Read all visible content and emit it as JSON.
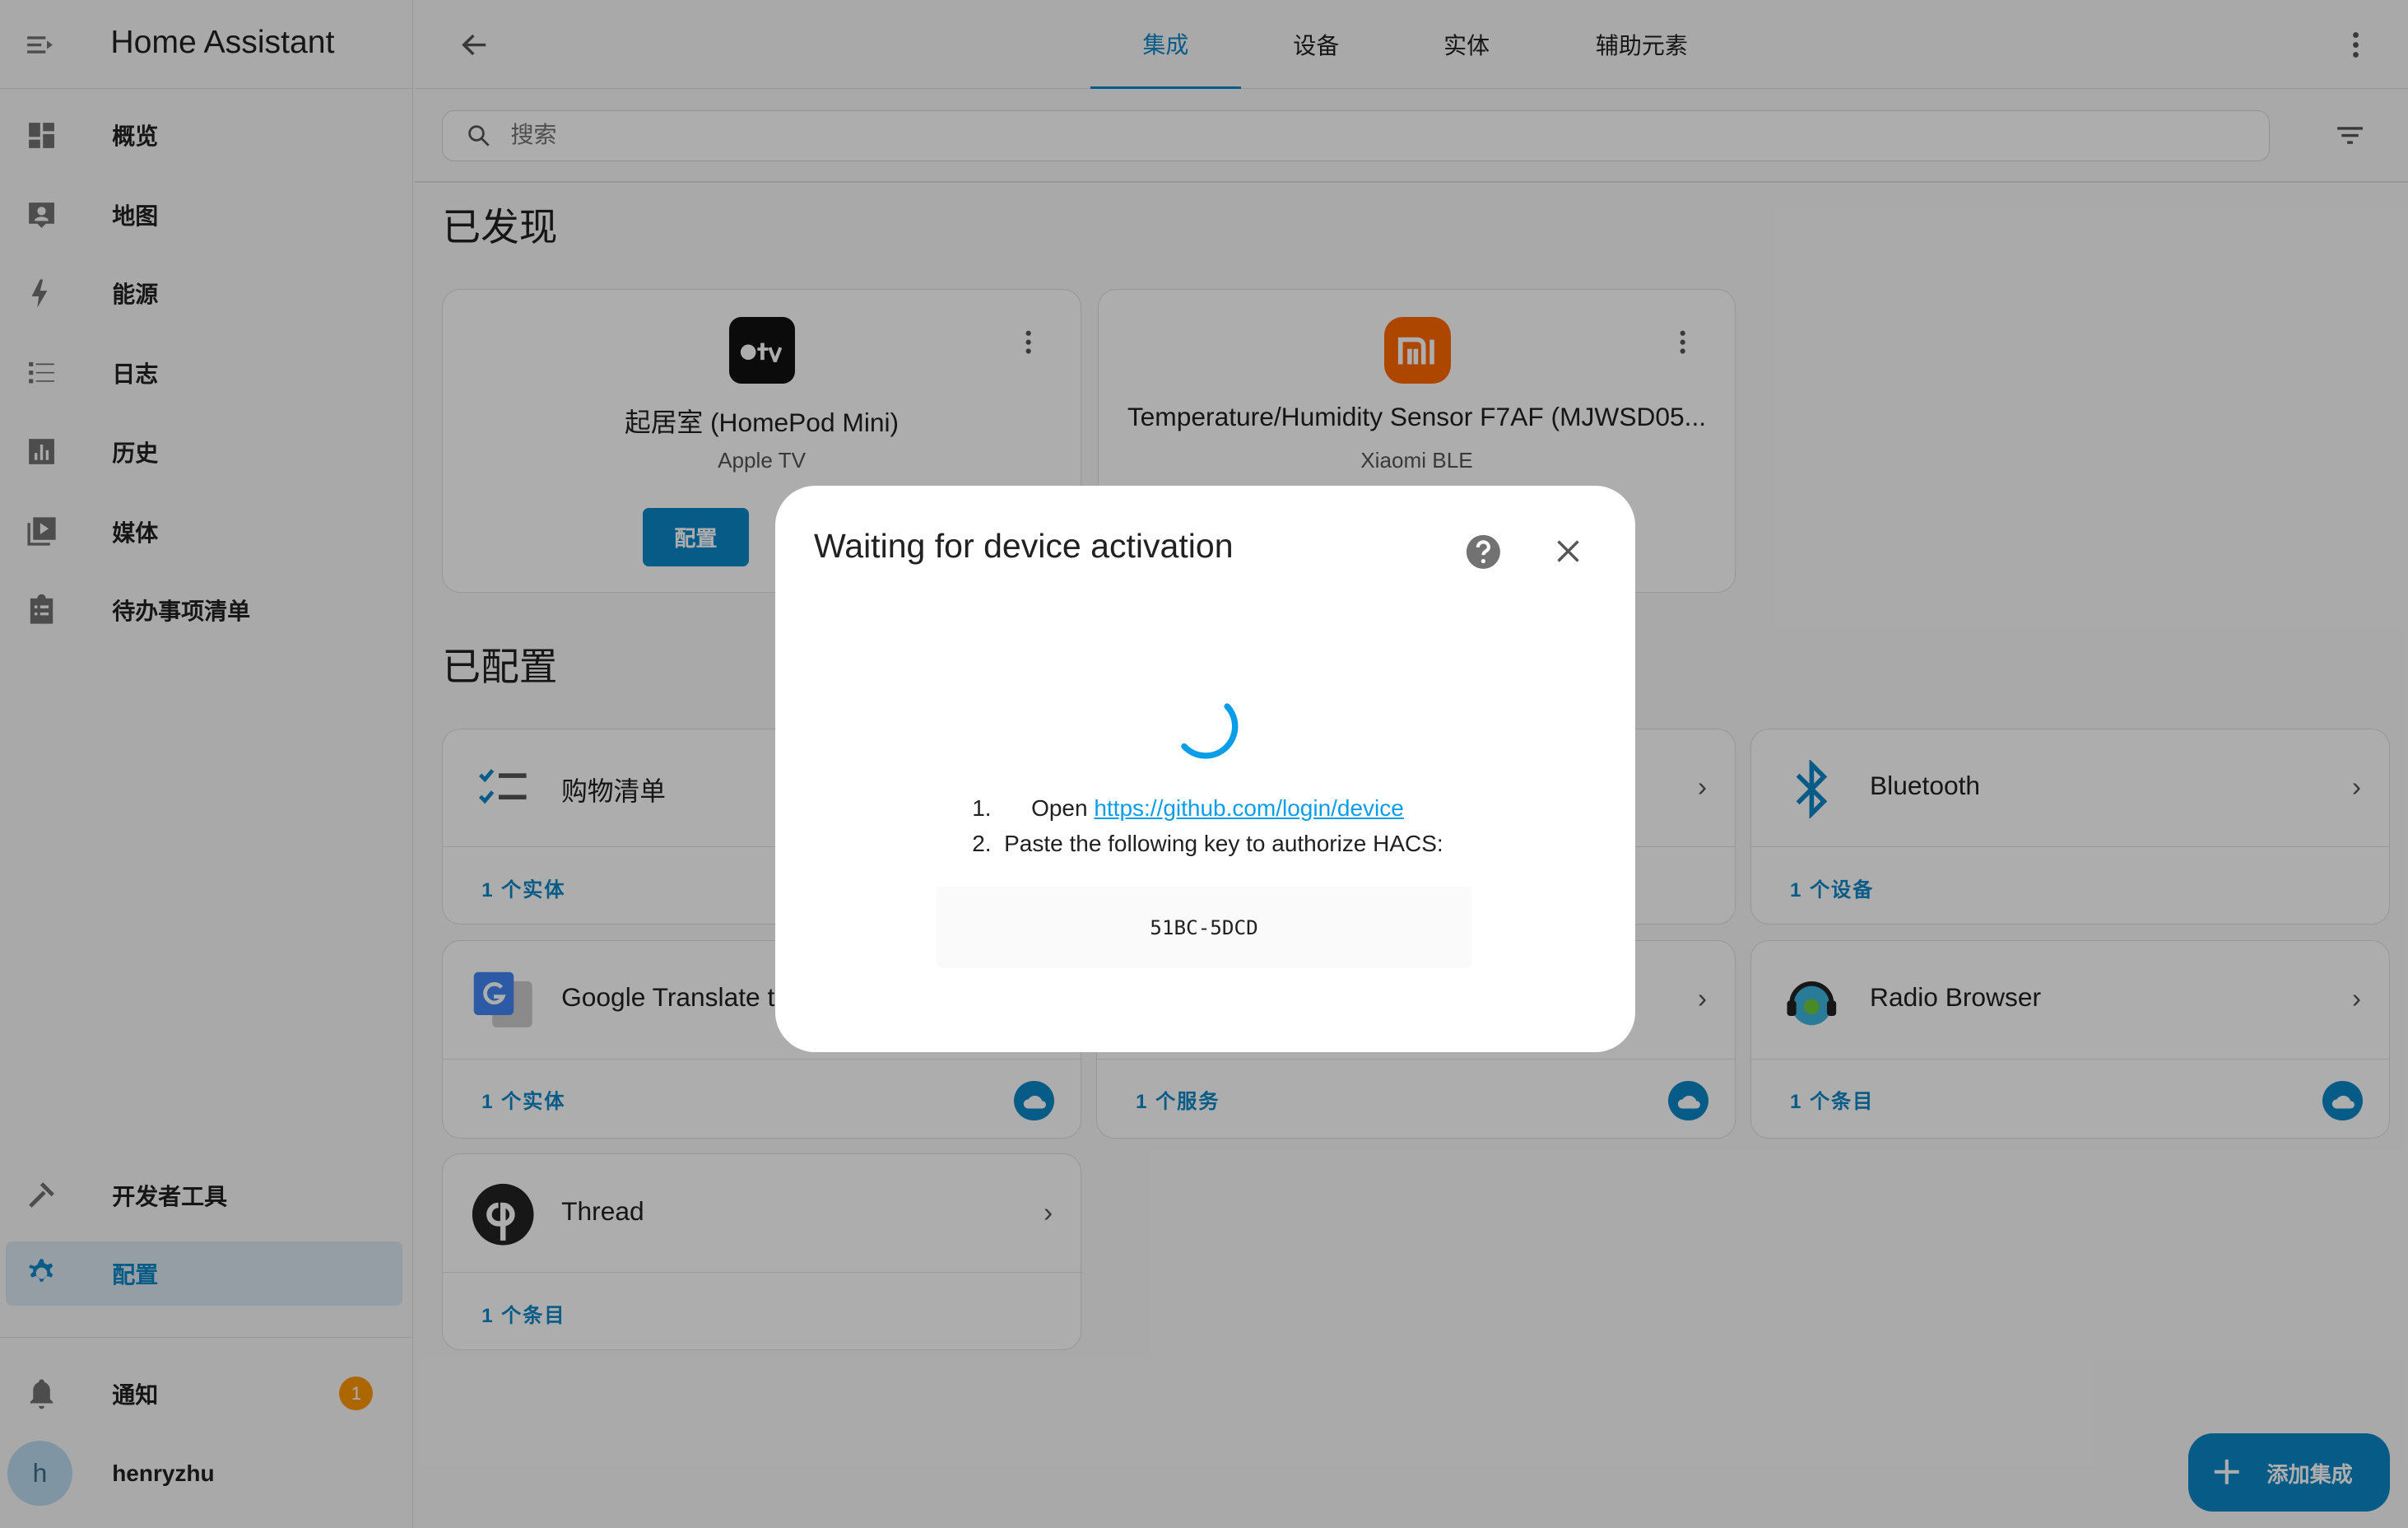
{
  "app": {
    "title": "Home Assistant"
  },
  "sidebar": {
    "items": [
      {
        "label": "概览",
        "icon": "dashboard-icon"
      },
      {
        "label": "地图",
        "icon": "map-icon"
      },
      {
        "label": "能源",
        "icon": "lightning-icon"
      },
      {
        "label": "日志",
        "icon": "list-icon"
      },
      {
        "label": "历史",
        "icon": "chart-icon"
      },
      {
        "label": "媒体",
        "icon": "media-icon"
      },
      {
        "label": "待办事项清单",
        "icon": "clipboard-icon"
      }
    ],
    "dev_tools": "开发者工具",
    "config": "配置",
    "notifications": "通知",
    "notification_count": "1",
    "user": "henryzhu",
    "user_initial": "h"
  },
  "header": {
    "tabs": [
      "集成",
      "设备",
      "实体",
      "辅助元素"
    ],
    "active_tab": "集成"
  },
  "search": {
    "placeholder": "搜索"
  },
  "discovered": {
    "title": "已发现",
    "cards": [
      {
        "name": "起居室 (HomePod Mini)",
        "integration": "Apple TV",
        "button": "配置",
        "icon": "apple-tv-icon"
      },
      {
        "name": "Temperature/Humidity Sensor F7AF (MJWSD05...",
        "integration": "Xiaomi BLE",
        "icon": "xiaomi-icon"
      }
    ]
  },
  "configured": {
    "title": "已配置",
    "cards": [
      {
        "name": "购物清单",
        "count": "1 个实体",
        "cloud": false,
        "icon": "shopping-list-icon"
      },
      {
        "name": "",
        "count": "",
        "cloud": false
      },
      {
        "name": "Bluetooth",
        "count": "1 个设备",
        "cloud": false,
        "icon": "bluetooth-icon"
      },
      {
        "name": "Google Translate t",
        "count": "1 个实体",
        "cloud": true,
        "icon": "google-translate-icon"
      },
      {
        "name": "",
        "count": "1 个服务",
        "cloud": true
      },
      {
        "name": "Radio Browser",
        "count": "1 个条目",
        "cloud": true,
        "icon": "radio-browser-icon"
      },
      {
        "name": "Thread",
        "count": "1 个条目",
        "cloud": false,
        "icon": "thread-icon"
      }
    ]
  },
  "dialog": {
    "title": "Waiting for device activation",
    "step1_num": "1.",
    "step1_text": "Open",
    "step1_link": "https://github.com/login/device",
    "step2_num": "2.",
    "step2_text": "Paste the following key to authorize HACS:",
    "code": "51BC-5DCD"
  },
  "fab": {
    "label": "添加集成"
  },
  "colors": {
    "accent": "#0a86c8",
    "badge": "#ff9800"
  }
}
